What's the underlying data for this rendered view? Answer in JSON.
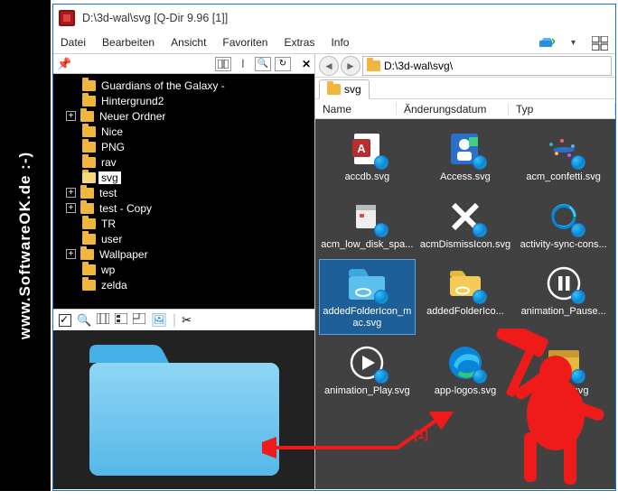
{
  "watermark": "www.SoftwareOK.de  :-)",
  "window": {
    "title": "D:\\3d-wal\\svg   [Q-Dir 9.96 [1]]"
  },
  "menu": [
    "Datei",
    "Bearbeiten",
    "Ansicht",
    "Favoriten",
    "Extras",
    "Info"
  ],
  "tree": {
    "items": [
      {
        "label": "Guardians of the Galaxy -",
        "expand": null
      },
      {
        "label": "Hintergrund2",
        "expand": null
      },
      {
        "label": "Neuer Ordner",
        "expand": "+"
      },
      {
        "label": "Nice",
        "expand": null
      },
      {
        "label": "PNG",
        "expand": null
      },
      {
        "label": "rav",
        "expand": null
      },
      {
        "label": "svg",
        "expand": null,
        "selected": true,
        "open": true
      },
      {
        "label": "test",
        "expand": "+"
      },
      {
        "label": "test - Copy",
        "expand": "+"
      },
      {
        "label": "TR",
        "expand": null
      },
      {
        "label": "user",
        "expand": null
      },
      {
        "label": "Wallpaper",
        "expand": "+"
      },
      {
        "label": "wp",
        "expand": null
      },
      {
        "label": "zelda",
        "expand": null
      }
    ]
  },
  "right": {
    "path": "D:\\3d-wal\\svg\\",
    "tab": "svg",
    "columns": [
      "Name",
      "Änderungsdatum",
      "Typ"
    ],
    "files": [
      {
        "name": "accdb.svg",
        "icon": "access-db"
      },
      {
        "name": "Access.svg",
        "icon": "access"
      },
      {
        "name": "acm_confetti.svg",
        "icon": "confetti"
      },
      {
        "name": "acm_low_disk_spa...",
        "icon": "lowdisk"
      },
      {
        "name": "acmDismissIcon.svg",
        "icon": "dismiss"
      },
      {
        "name": "activity-sync-cons...",
        "icon": "sync"
      },
      {
        "name": "addedFolderIcon_mac.svg",
        "icon": "folder-link",
        "selected": true
      },
      {
        "name": "addedFolderIco...",
        "icon": "folder-link2"
      },
      {
        "name": "animation_Pause...",
        "icon": "pause"
      },
      {
        "name": "animation_Play.svg",
        "icon": "play"
      },
      {
        "name": "app-logos.svg",
        "icon": "edge"
      },
      {
        "name": "archive.svg",
        "icon": "archive"
      }
    ]
  },
  "annotation_label": "[1]"
}
